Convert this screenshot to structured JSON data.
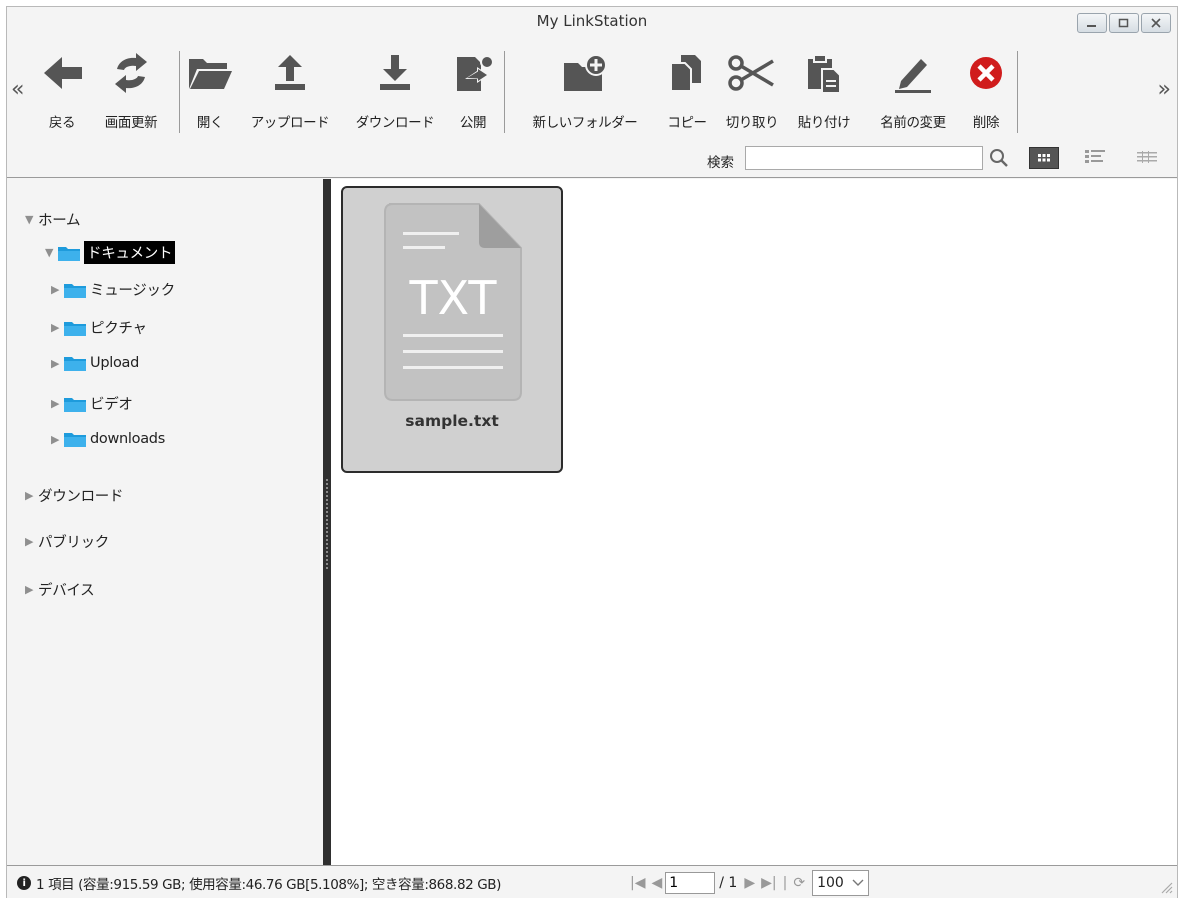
{
  "window": {
    "title": "My LinkStation"
  },
  "toolbar": {
    "collapse_left": "«",
    "expand_right": "»",
    "items": [
      {
        "label": "戻る",
        "icon": "back-arrow-icon"
      },
      {
        "label": "画面更新",
        "icon": "refresh-icon"
      },
      {
        "label": "開く",
        "icon": "open-folder-icon"
      },
      {
        "label": "アップロード",
        "icon": "upload-icon"
      },
      {
        "label": "ダウンロード",
        "icon": "download-icon"
      },
      {
        "label": "公開",
        "icon": "publish-icon"
      },
      {
        "label": "新しいフォルダー",
        "icon": "new-folder-icon"
      },
      {
        "label": "コピー",
        "icon": "copy-icon"
      },
      {
        "label": "切り取り",
        "icon": "cut-icon"
      },
      {
        "label": "貼り付け",
        "icon": "paste-icon"
      },
      {
        "label": "名前の変更",
        "icon": "rename-icon"
      },
      {
        "label": "削除",
        "icon": "delete-icon"
      }
    ]
  },
  "search": {
    "label": "検索",
    "value": ""
  },
  "sidebar": {
    "home": "ホーム",
    "folders": [
      "ドキュメント",
      "ミュージック",
      "ピクチャ",
      "Upload",
      "ビデオ",
      "downloads"
    ],
    "selected": "ドキュメント",
    "sections": [
      "ダウンロード",
      "パブリック",
      "デバイス"
    ]
  },
  "content": {
    "files": [
      {
        "name": "sample.txt",
        "type_label": "TXT"
      }
    ]
  },
  "status": {
    "text": "1 項目 (容量:915.59 GB; 使用容量:46.76 GB[5.108%]; 空き容量:868.82 GB)",
    "page": "1",
    "page_total": "/ 1",
    "page_size": "100"
  },
  "colors": {
    "folder": "#1e9bdc",
    "delete": "#d01c1c",
    "selected_bg": "#000000"
  }
}
